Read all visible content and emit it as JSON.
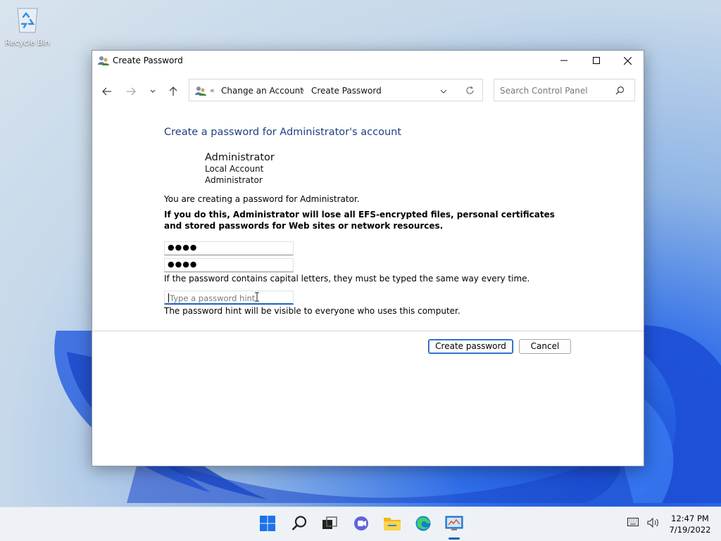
{
  "desktop": {
    "recycle_bin_label": "Recycle Bin"
  },
  "window": {
    "title": "Create Password",
    "controls": {
      "minimize": "minimize",
      "maximize": "maximize",
      "close": "close"
    }
  },
  "address_bar": {
    "overflow": "«",
    "crumbs": [
      "Change an Account",
      "Create Password"
    ],
    "separator": "›"
  },
  "search": {
    "placeholder": "Search Control Panel"
  },
  "page": {
    "heading": "Create a password for Administrator's account",
    "account": {
      "name": "Administrator",
      "type": "Local Account",
      "group": "Administrator"
    },
    "info_line": "You are creating a password for Administrator.",
    "warning": "If you do this, Administrator will lose all EFS-encrypted files, personal certificates and stored passwords for Web sites or network resources.",
    "new_password_value": "●●●●",
    "confirm_password_value": "●●●●",
    "caps_note": "If the password contains capital letters, they must be typed the same way every time.",
    "hint_placeholder": "Type a password hint",
    "hint_note": "The password hint will be visible to everyone who uses this computer.",
    "create_button": "Create password",
    "cancel_button": "Cancel"
  },
  "taskbar": {
    "apps": [
      "start-icon",
      "search-icon",
      "task-view-icon",
      "chat-icon",
      "file-explorer-icon",
      "edge-icon",
      "control-panel-icon"
    ],
    "time": "12:47 PM",
    "date": "7/19/2022"
  },
  "colors": {
    "heading": "#1e3f80",
    "accent": "#1f5fbf"
  }
}
